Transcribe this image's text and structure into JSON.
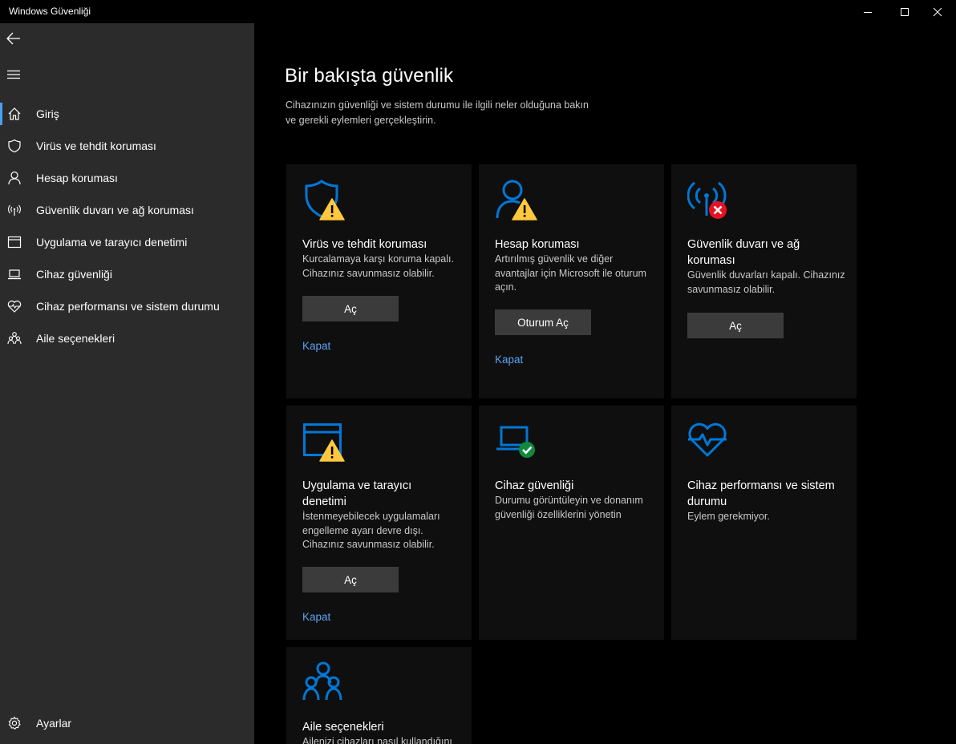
{
  "window": {
    "title": "Windows Güvenliği"
  },
  "sidebar": {
    "items": [
      {
        "label": "Giriş",
        "icon": "home-icon",
        "active": true
      },
      {
        "label": "Virüs ve tehdit koruması",
        "icon": "shield-icon"
      },
      {
        "label": "Hesap koruması",
        "icon": "person-icon"
      },
      {
        "label": "Güvenlik duvarı ve ağ koruması",
        "icon": "wireless-icon"
      },
      {
        "label": "Uygulama ve tarayıcı denetimi",
        "icon": "app-window-icon"
      },
      {
        "label": "Cihaz güvenliği",
        "icon": "laptop-icon"
      },
      {
        "label": "Cihaz performansı ve sistem durumu",
        "icon": "heart-pulse-icon"
      },
      {
        "label": "Aile seçenekleri",
        "icon": "family-icon"
      }
    ],
    "settings_label": "Ayarlar"
  },
  "main": {
    "title": "Bir bakışta güvenlik",
    "description": "Cihazınızın güvenliği ve sistem durumu ile ilgili neler olduğuna bakın ve gerekli eylemleri gerçekleştirin.",
    "cards": [
      {
        "title": "Virüs ve tehdit koruması",
        "description": "Kurcalamaya karşı koruma kapalı. Cihazınız savunmasız olabilir.",
        "button": "Aç",
        "link": "Kapat",
        "icon": "shield-warning-icon",
        "status": "warning"
      },
      {
        "title": "Hesap koruması",
        "description": "Artırılmış güvenlik ve diğer avantajlar için Microsoft ile oturum açın.",
        "button": "Oturum Aç",
        "link": "Kapat",
        "icon": "person-warning-icon",
        "status": "warning"
      },
      {
        "title": "Güvenlik duvarı ve ağ koruması",
        "description": "Güvenlik duvarları kapalı. Cihazınız savunmasız olabilir.",
        "button": "Aç",
        "icon": "wireless-error-icon",
        "status": "error"
      },
      {
        "title": "Uygulama ve tarayıcı denetimi",
        "description": "İstenmeyebilecek uygulamaları engelleme ayarı devre dışı. Cihazınız savunmasız olabilir.",
        "button": "Aç",
        "link": "Kapat",
        "icon": "app-window-warning-icon",
        "status": "warning"
      },
      {
        "title": "Cihaz güvenliği",
        "description": "Durumu görüntüleyin ve donanım güvenliği özelliklerini yönetin",
        "icon": "laptop-ok-icon",
        "status": "ok"
      },
      {
        "title": "Cihaz performansı ve sistem durumu",
        "description": "Eylem gerekmiyor.",
        "icon": "heart-pulse-icon",
        "status": "ok"
      },
      {
        "title": "Aile seçenekleri",
        "description": "Ailenizi cihazları nasıl kullandığını",
        "icon": "family-icon",
        "status": "none"
      }
    ]
  },
  "colors": {
    "accent": "#0078d7",
    "link": "#5aa3f0",
    "warning": "#ffc83d",
    "error": "#e81123",
    "ok": "#10893e",
    "sidebar_bg": "#2b2b2b",
    "card_bg": "#0f0f0f"
  }
}
